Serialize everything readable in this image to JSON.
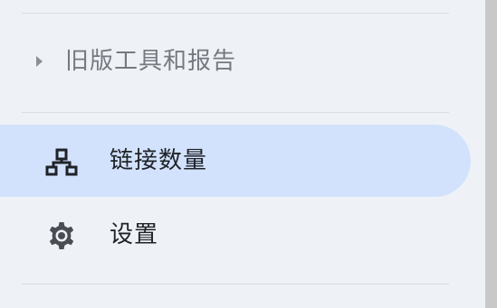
{
  "sidebar": {
    "legacy_section": {
      "label": "旧版工具和报告",
      "icon": "caret-right-icon"
    },
    "items": [
      {
        "label": "链接数量",
        "icon": "sitemap-icon",
        "active": true
      },
      {
        "label": "设置",
        "icon": "gear-icon",
        "active": false
      }
    ]
  },
  "colors": {
    "background": "#eef2f7",
    "active_background": "#d3e2fc",
    "divider": "#d9dde3",
    "muted_text": "#757a80",
    "text": "#1f2328",
    "scrollbar": "#c8c8c8"
  }
}
